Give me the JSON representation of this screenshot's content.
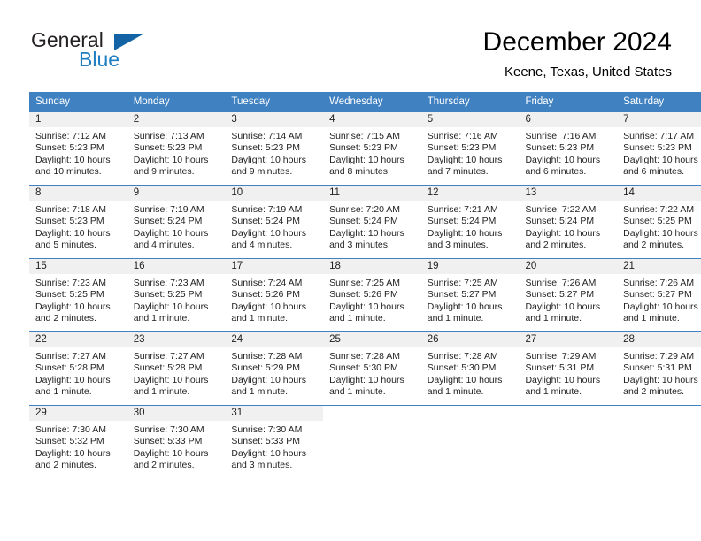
{
  "brand": {
    "name_top": "General",
    "name_bottom": "Blue",
    "top_color": "#231f20",
    "bottom_color": "#1f7ec1",
    "triangle_color": "#1464a5",
    "triangle_icon": "triangle-icon"
  },
  "header": {
    "title": "December 2024",
    "subtitle": "Keene, Texas, United States"
  },
  "theme": {
    "header_bg": "#3f81c1",
    "header_text": "#ffffff",
    "daynum_band_bg": "#f0f0f0",
    "row_border": "#3f81c1"
  },
  "weekdays": [
    "Sunday",
    "Monday",
    "Tuesday",
    "Wednesday",
    "Thursday",
    "Friday",
    "Saturday"
  ],
  "weeks": [
    [
      {
        "day": "1",
        "sunrise": "Sunrise: 7:12 AM",
        "sunset": "Sunset: 5:23 PM",
        "daylight_line1": "Daylight: 10 hours",
        "daylight_line2": "and 10 minutes."
      },
      {
        "day": "2",
        "sunrise": "Sunrise: 7:13 AM",
        "sunset": "Sunset: 5:23 PM",
        "daylight_line1": "Daylight: 10 hours",
        "daylight_line2": "and 9 minutes."
      },
      {
        "day": "3",
        "sunrise": "Sunrise: 7:14 AM",
        "sunset": "Sunset: 5:23 PM",
        "daylight_line1": "Daylight: 10 hours",
        "daylight_line2": "and 9 minutes."
      },
      {
        "day": "4",
        "sunrise": "Sunrise: 7:15 AM",
        "sunset": "Sunset: 5:23 PM",
        "daylight_line1": "Daylight: 10 hours",
        "daylight_line2": "and 8 minutes."
      },
      {
        "day": "5",
        "sunrise": "Sunrise: 7:16 AM",
        "sunset": "Sunset: 5:23 PM",
        "daylight_line1": "Daylight: 10 hours",
        "daylight_line2": "and 7 minutes."
      },
      {
        "day": "6",
        "sunrise": "Sunrise: 7:16 AM",
        "sunset": "Sunset: 5:23 PM",
        "daylight_line1": "Daylight: 10 hours",
        "daylight_line2": "and 6 minutes."
      },
      {
        "day": "7",
        "sunrise": "Sunrise: 7:17 AM",
        "sunset": "Sunset: 5:23 PM",
        "daylight_line1": "Daylight: 10 hours",
        "daylight_line2": "and 6 minutes."
      }
    ],
    [
      {
        "day": "8",
        "sunrise": "Sunrise: 7:18 AM",
        "sunset": "Sunset: 5:23 PM",
        "daylight_line1": "Daylight: 10 hours",
        "daylight_line2": "and 5 minutes."
      },
      {
        "day": "9",
        "sunrise": "Sunrise: 7:19 AM",
        "sunset": "Sunset: 5:24 PM",
        "daylight_line1": "Daylight: 10 hours",
        "daylight_line2": "and 4 minutes."
      },
      {
        "day": "10",
        "sunrise": "Sunrise: 7:19 AM",
        "sunset": "Sunset: 5:24 PM",
        "daylight_line1": "Daylight: 10 hours",
        "daylight_line2": "and 4 minutes."
      },
      {
        "day": "11",
        "sunrise": "Sunrise: 7:20 AM",
        "sunset": "Sunset: 5:24 PM",
        "daylight_line1": "Daylight: 10 hours",
        "daylight_line2": "and 3 minutes."
      },
      {
        "day": "12",
        "sunrise": "Sunrise: 7:21 AM",
        "sunset": "Sunset: 5:24 PM",
        "daylight_line1": "Daylight: 10 hours",
        "daylight_line2": "and 3 minutes."
      },
      {
        "day": "13",
        "sunrise": "Sunrise: 7:22 AM",
        "sunset": "Sunset: 5:24 PM",
        "daylight_line1": "Daylight: 10 hours",
        "daylight_line2": "and 2 minutes."
      },
      {
        "day": "14",
        "sunrise": "Sunrise: 7:22 AM",
        "sunset": "Sunset: 5:25 PM",
        "daylight_line1": "Daylight: 10 hours",
        "daylight_line2": "and 2 minutes."
      }
    ],
    [
      {
        "day": "15",
        "sunrise": "Sunrise: 7:23 AM",
        "sunset": "Sunset: 5:25 PM",
        "daylight_line1": "Daylight: 10 hours",
        "daylight_line2": "and 2 minutes."
      },
      {
        "day": "16",
        "sunrise": "Sunrise: 7:23 AM",
        "sunset": "Sunset: 5:25 PM",
        "daylight_line1": "Daylight: 10 hours",
        "daylight_line2": "and 1 minute."
      },
      {
        "day": "17",
        "sunrise": "Sunrise: 7:24 AM",
        "sunset": "Sunset: 5:26 PM",
        "daylight_line1": "Daylight: 10 hours",
        "daylight_line2": "and 1 minute."
      },
      {
        "day": "18",
        "sunrise": "Sunrise: 7:25 AM",
        "sunset": "Sunset: 5:26 PM",
        "daylight_line1": "Daylight: 10 hours",
        "daylight_line2": "and 1 minute."
      },
      {
        "day": "19",
        "sunrise": "Sunrise: 7:25 AM",
        "sunset": "Sunset: 5:27 PM",
        "daylight_line1": "Daylight: 10 hours",
        "daylight_line2": "and 1 minute."
      },
      {
        "day": "20",
        "sunrise": "Sunrise: 7:26 AM",
        "sunset": "Sunset: 5:27 PM",
        "daylight_line1": "Daylight: 10 hours",
        "daylight_line2": "and 1 minute."
      },
      {
        "day": "21",
        "sunrise": "Sunrise: 7:26 AM",
        "sunset": "Sunset: 5:27 PM",
        "daylight_line1": "Daylight: 10 hours",
        "daylight_line2": "and 1 minute."
      }
    ],
    [
      {
        "day": "22",
        "sunrise": "Sunrise: 7:27 AM",
        "sunset": "Sunset: 5:28 PM",
        "daylight_line1": "Daylight: 10 hours",
        "daylight_line2": "and 1 minute."
      },
      {
        "day": "23",
        "sunrise": "Sunrise: 7:27 AM",
        "sunset": "Sunset: 5:28 PM",
        "daylight_line1": "Daylight: 10 hours",
        "daylight_line2": "and 1 minute."
      },
      {
        "day": "24",
        "sunrise": "Sunrise: 7:28 AM",
        "sunset": "Sunset: 5:29 PM",
        "daylight_line1": "Daylight: 10 hours",
        "daylight_line2": "and 1 minute."
      },
      {
        "day": "25",
        "sunrise": "Sunrise: 7:28 AM",
        "sunset": "Sunset: 5:30 PM",
        "daylight_line1": "Daylight: 10 hours",
        "daylight_line2": "and 1 minute."
      },
      {
        "day": "26",
        "sunrise": "Sunrise: 7:28 AM",
        "sunset": "Sunset: 5:30 PM",
        "daylight_line1": "Daylight: 10 hours",
        "daylight_line2": "and 1 minute."
      },
      {
        "day": "27",
        "sunrise": "Sunrise: 7:29 AM",
        "sunset": "Sunset: 5:31 PM",
        "daylight_line1": "Daylight: 10 hours",
        "daylight_line2": "and 1 minute."
      },
      {
        "day": "28",
        "sunrise": "Sunrise: 7:29 AM",
        "sunset": "Sunset: 5:31 PM",
        "daylight_line1": "Daylight: 10 hours",
        "daylight_line2": "and 2 minutes."
      }
    ],
    [
      {
        "day": "29",
        "sunrise": "Sunrise: 7:30 AM",
        "sunset": "Sunset: 5:32 PM",
        "daylight_line1": "Daylight: 10 hours",
        "daylight_line2": "and 2 minutes."
      },
      {
        "day": "30",
        "sunrise": "Sunrise: 7:30 AM",
        "sunset": "Sunset: 5:33 PM",
        "daylight_line1": "Daylight: 10 hours",
        "daylight_line2": "and 2 minutes."
      },
      {
        "day": "31",
        "sunrise": "Sunrise: 7:30 AM",
        "sunset": "Sunset: 5:33 PM",
        "daylight_line1": "Daylight: 10 hours",
        "daylight_line2": "and 3 minutes."
      },
      {
        "day": "",
        "sunrise": "",
        "sunset": "",
        "daylight_line1": "",
        "daylight_line2": ""
      },
      {
        "day": "",
        "sunrise": "",
        "sunset": "",
        "daylight_line1": "",
        "daylight_line2": ""
      },
      {
        "day": "",
        "sunrise": "",
        "sunset": "",
        "daylight_line1": "",
        "daylight_line2": ""
      },
      {
        "day": "",
        "sunrise": "",
        "sunset": "",
        "daylight_line1": "",
        "daylight_line2": ""
      }
    ]
  ]
}
